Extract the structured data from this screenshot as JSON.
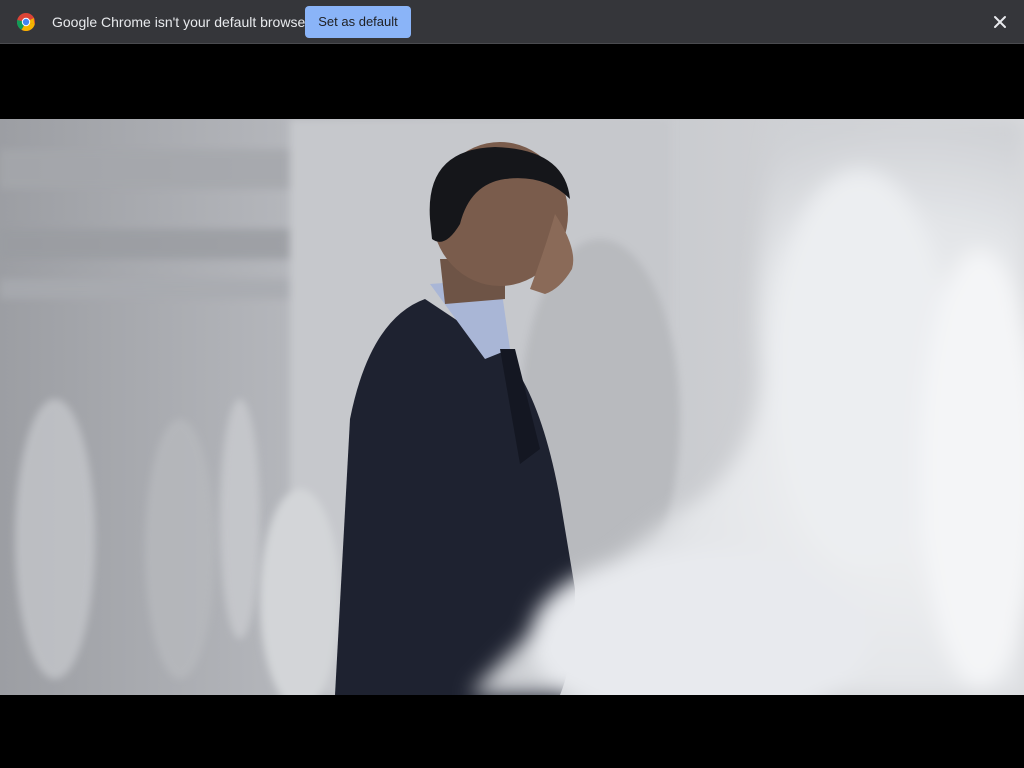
{
  "infobar": {
    "message": "Google Chrome isn't your default browser",
    "set_default_label": "Set as default",
    "icon": "chrome-logo-icon",
    "close_icon": "close-icon"
  },
  "video": {
    "description_icon": "video-player"
  },
  "colors": {
    "infobar_bg": "#35363a",
    "button_bg": "#8ab4f8",
    "button_text": "#202124",
    "text": "#e8eaed",
    "page_bg": "#000000"
  }
}
